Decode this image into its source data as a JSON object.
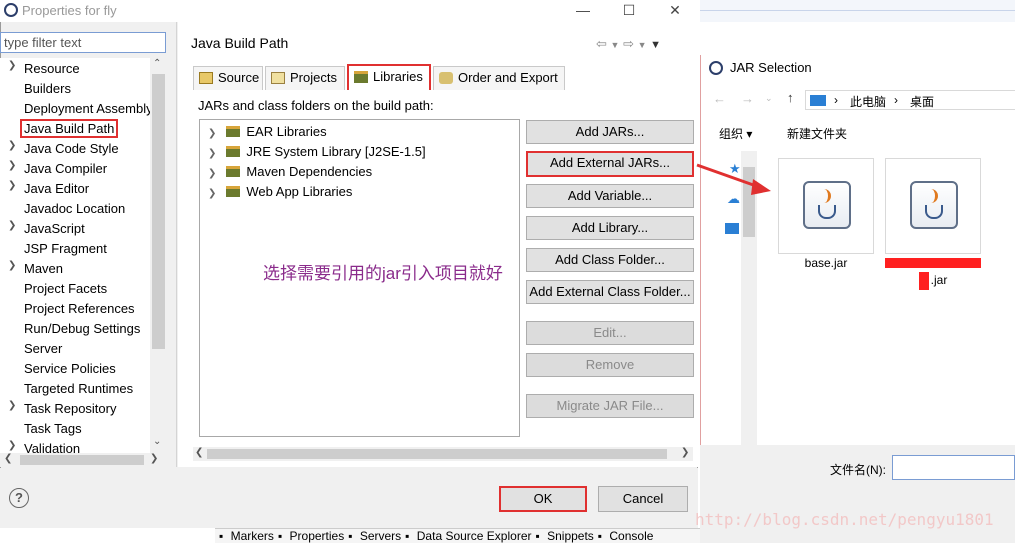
{
  "dialog": {
    "title": "Properties for fly",
    "filter_placeholder": "type filter text",
    "page_title": "Java Build Path"
  },
  "tree": [
    {
      "label": "Resource",
      "expandable": true
    },
    {
      "label": "Builders",
      "expandable": false
    },
    {
      "label": "Deployment Assembly",
      "expandable": false
    },
    {
      "label": "Java Build Path",
      "expandable": false,
      "selected": true
    },
    {
      "label": "Java Code Style",
      "expandable": true
    },
    {
      "label": "Java Compiler",
      "expandable": true
    },
    {
      "label": "Java Editor",
      "expandable": true
    },
    {
      "label": "Javadoc Location",
      "expandable": false
    },
    {
      "label": "JavaScript",
      "expandable": true
    },
    {
      "label": "JSP Fragment",
      "expandable": false
    },
    {
      "label": "Maven",
      "expandable": true
    },
    {
      "label": "Project Facets",
      "expandable": false
    },
    {
      "label": "Project References",
      "expandable": false
    },
    {
      "label": "Run/Debug Settings",
      "expandable": false
    },
    {
      "label": "Server",
      "expandable": false
    },
    {
      "label": "Service Policies",
      "expandable": false
    },
    {
      "label": "Targeted Runtimes",
      "expandable": false
    },
    {
      "label": "Task Repository",
      "expandable": true
    },
    {
      "label": "Task Tags",
      "expandable": false
    },
    {
      "label": "Validation",
      "expandable": true
    }
  ],
  "tabs": [
    "Source",
    "Projects",
    "Libraries",
    "Order and Export"
  ],
  "libraries_label": "JARs and class folders on the build path:",
  "libraries": [
    "EAR Libraries",
    "JRE System Library [J2SE-1.5]",
    "Maven Dependencies",
    "Web App Libraries"
  ],
  "buttons": {
    "add_jars": "Add JARs...",
    "add_external_jars": "Add External JARs...",
    "add_variable": "Add Variable...",
    "add_library": "Add Library...",
    "add_class_folder": "Add Class Folder...",
    "add_external_class_folder": "Add External Class Folder...",
    "edit": "Edit...",
    "remove": "Remove",
    "migrate": "Migrate JAR File...",
    "ok": "OK",
    "cancel": "Cancel"
  },
  "annotation": "选择需要引用的jar引入项目就好",
  "bottom_tabs": [
    "Markers",
    "Properties",
    "Servers",
    "Data Source Explorer",
    "Snippets",
    "Console"
  ],
  "jar_dialog": {
    "title": "JAR Selection",
    "crumb1": "此电脑",
    "crumb2": "桌面",
    "organize": "组织",
    "new_folder": "新建文件夹",
    "files": [
      "base.jar",
      ".jar"
    ],
    "filename_label": "文件名(N):"
  },
  "watermark": "http://blog.csdn.net/pengyu1801"
}
